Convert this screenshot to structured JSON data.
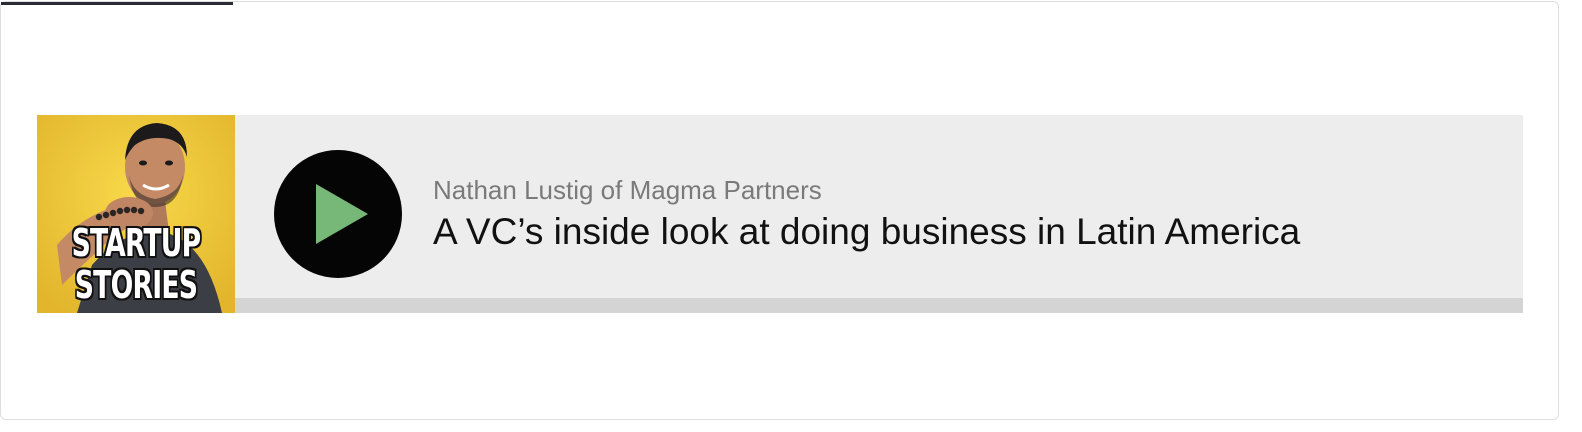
{
  "player": {
    "artwork": {
      "line1": "STARTUP",
      "line2": "STORIES",
      "background_color": "#f2c53a"
    },
    "play_button": {
      "icon": "play-icon",
      "icon_color": "#77b777",
      "background_color": "#050505"
    },
    "episode": {
      "guest": "Nathan Lustig of Magma Partners",
      "title": "A VC’s inside look at doing business in Latin America"
    },
    "progress": {
      "fraction_played": 0.0
    }
  }
}
